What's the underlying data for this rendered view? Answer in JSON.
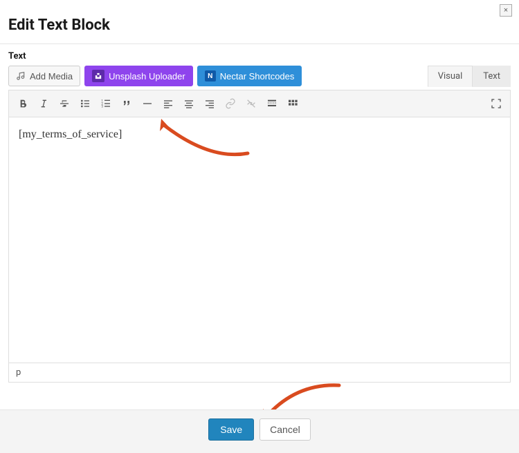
{
  "modal": {
    "title": "Edit Text Block",
    "close_label": "×"
  },
  "field": {
    "label": "Text"
  },
  "buttons": {
    "add_media": "Add Media",
    "unsplash": "Unsplash Uploader",
    "nectar": "Nectar Shortcodes",
    "nectar_badge": "N"
  },
  "tabs": {
    "visual": "Visual",
    "text": "Text"
  },
  "toolbar": {
    "items": [
      {
        "name": "bold-icon",
        "interactable": true
      },
      {
        "name": "italic-icon",
        "interactable": true
      },
      {
        "name": "strikethrough-icon",
        "interactable": true
      },
      {
        "name": "bullet-list-icon",
        "interactable": true
      },
      {
        "name": "numbered-list-icon",
        "interactable": true
      },
      {
        "name": "blockquote-icon",
        "interactable": true
      },
      {
        "name": "horizontal-rule-icon",
        "interactable": true
      },
      {
        "name": "align-left-icon",
        "interactable": true
      },
      {
        "name": "align-center-icon",
        "interactable": true
      },
      {
        "name": "align-right-icon",
        "interactable": true
      },
      {
        "name": "link-icon",
        "interactable": false
      },
      {
        "name": "unlink-icon",
        "interactable": false
      },
      {
        "name": "read-more-icon",
        "interactable": true
      },
      {
        "name": "toolbar-toggle-icon",
        "interactable": true
      }
    ],
    "fullscreen": "fullscreen-icon"
  },
  "editor": {
    "content": "[my_terms_of_service]",
    "status_path": "p"
  },
  "footer": {
    "save": "Save",
    "cancel": "Cancel"
  },
  "annotations": {
    "arrow_top": "points-to-shortcode",
    "arrow_bottom": "points-to-save-button"
  }
}
